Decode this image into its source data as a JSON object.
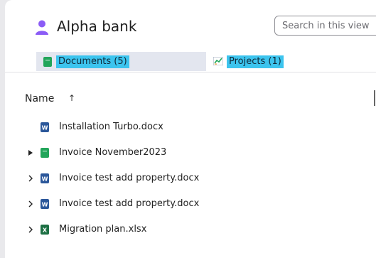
{
  "app": {
    "title": "Alpha bank"
  },
  "search": {
    "placeholder": "Search in this view"
  },
  "tabs": [
    {
      "label": "Documents (5)",
      "icon": "green-document-icon",
      "selected": true
    },
    {
      "label": "Projects (1)",
      "icon": "chart-icon",
      "selected": false
    }
  ],
  "list": {
    "column_name": "Name",
    "sort_icon": "↑",
    "items": [
      {
        "name": "Installation Turbo.docx",
        "icon": "word-file-icon",
        "expander": "none"
      },
      {
        "name": "Invoice November2023",
        "icon": "green-document-icon",
        "expander": "filled-triangle"
      },
      {
        "name": "Invoice test add property.docx",
        "icon": "word-file-icon",
        "expander": "chevron"
      },
      {
        "name": "Invoice test add property.docx",
        "icon": "word-file-icon",
        "expander": "chevron"
      },
      {
        "name": "Migration plan.xlsx",
        "icon": "excel-file-icon",
        "expander": "chevron"
      }
    ]
  },
  "colors": {
    "accent_highlight": "#3cc4ee",
    "avatar": "#8b5cf6",
    "word": "#2b579a",
    "excel": "#1d7044",
    "doc_green": "#22a55a"
  }
}
